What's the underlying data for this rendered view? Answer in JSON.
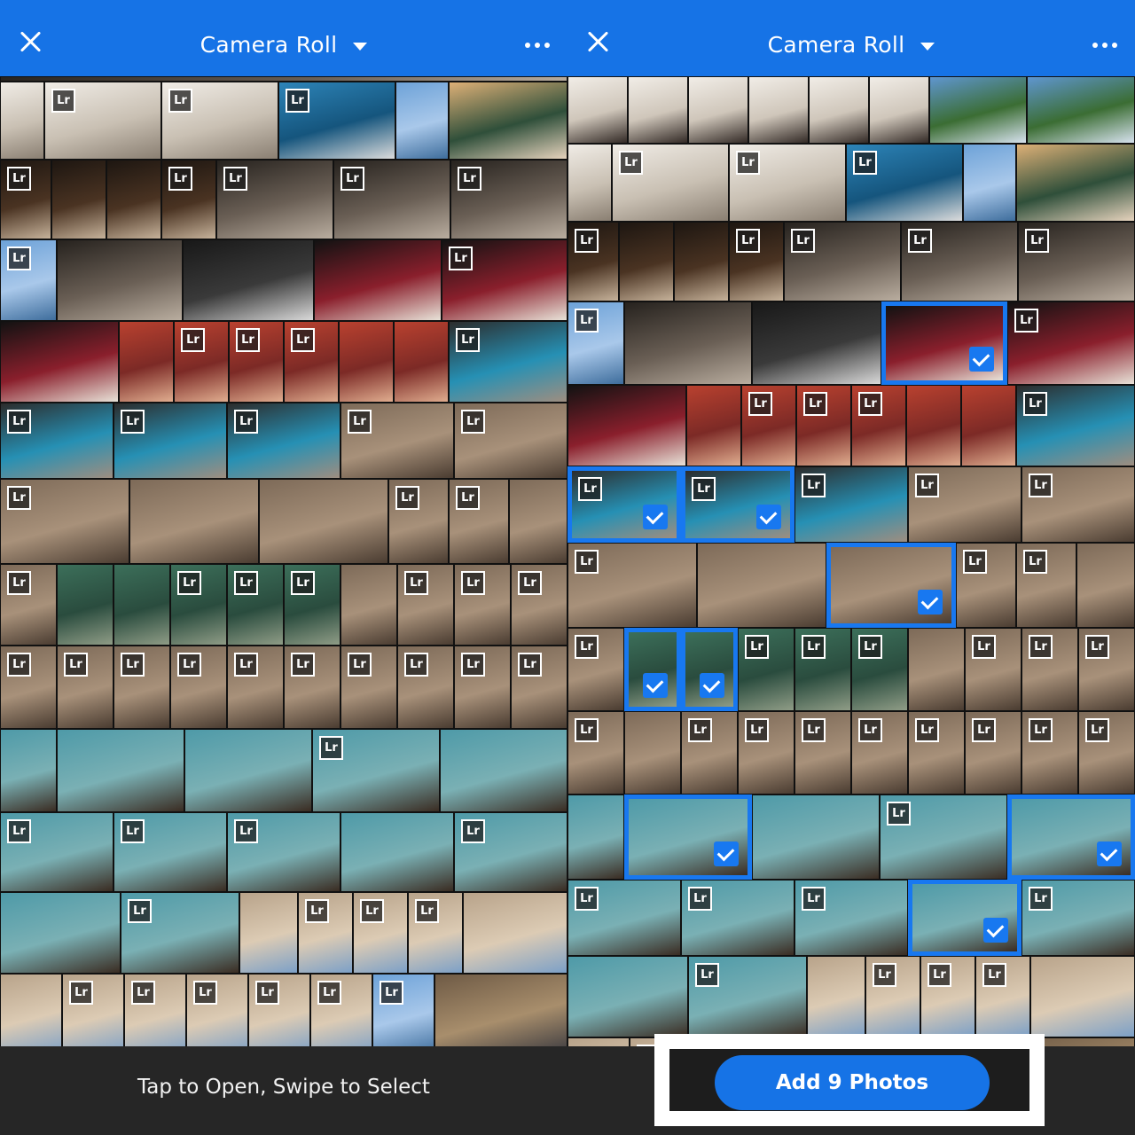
{
  "left_panel": {
    "header": {
      "title": "Camera Roll"
    },
    "lr_badge": "Lr",
    "footer": {
      "hint": "Tap to Open, Swipe to Select"
    }
  },
  "right_panel": {
    "header": {
      "title": "Camera Roll"
    },
    "lr_badge": "Lr",
    "footer": {
      "add_button_label": "Add 9 Photos"
    }
  },
  "icons": {
    "close": "close-icon",
    "dropdown": "chevron-down-icon",
    "more": "more-options-icon",
    "selected": "checkmark-icon",
    "badge": "lightroom-badge-icon"
  },
  "colors": {
    "accent": "#1673e6",
    "selection": "#1878f0",
    "footer": "#262626"
  }
}
